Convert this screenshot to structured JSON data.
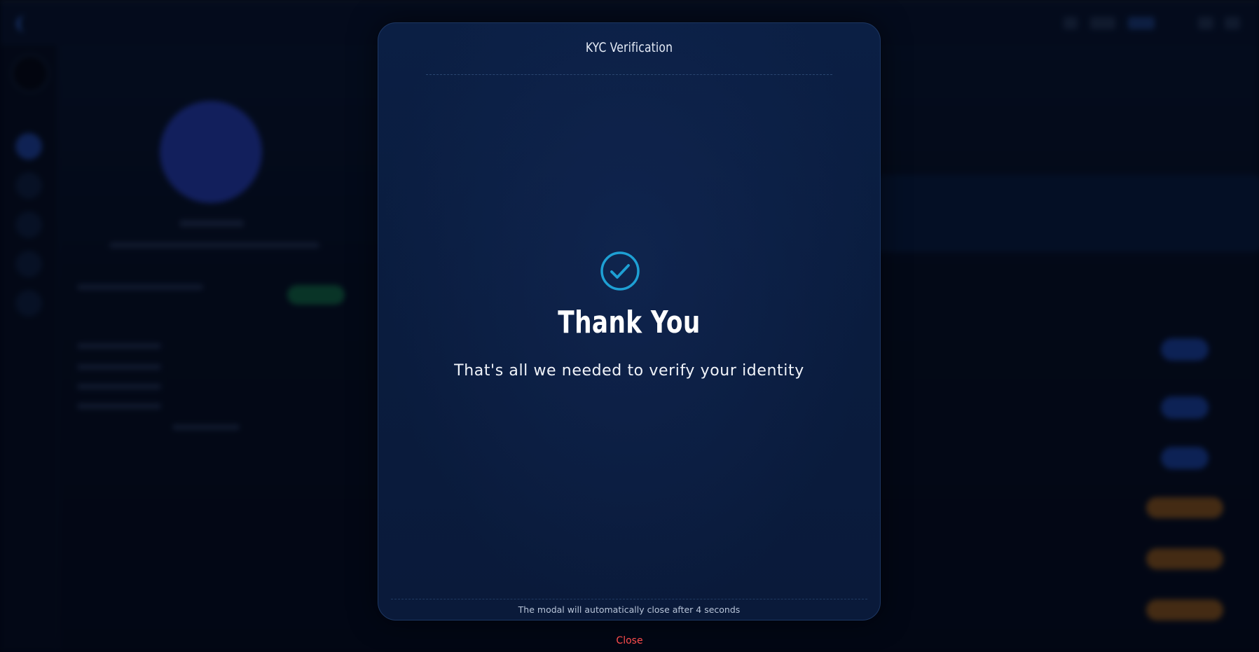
{
  "modal": {
    "title": "KYC Verification",
    "heading": "Thank You",
    "message": "That's all we needed to verify your identity",
    "auto_close_notice": "The modal will automatically close after 4 seconds",
    "close_label": "Close",
    "status_icon": "check-circle-icon"
  },
  "colors": {
    "accent": "#1ea0d4",
    "close": "#ff4d4d",
    "modal_background": "#0a1c3e",
    "page_background": "#040b1c"
  }
}
